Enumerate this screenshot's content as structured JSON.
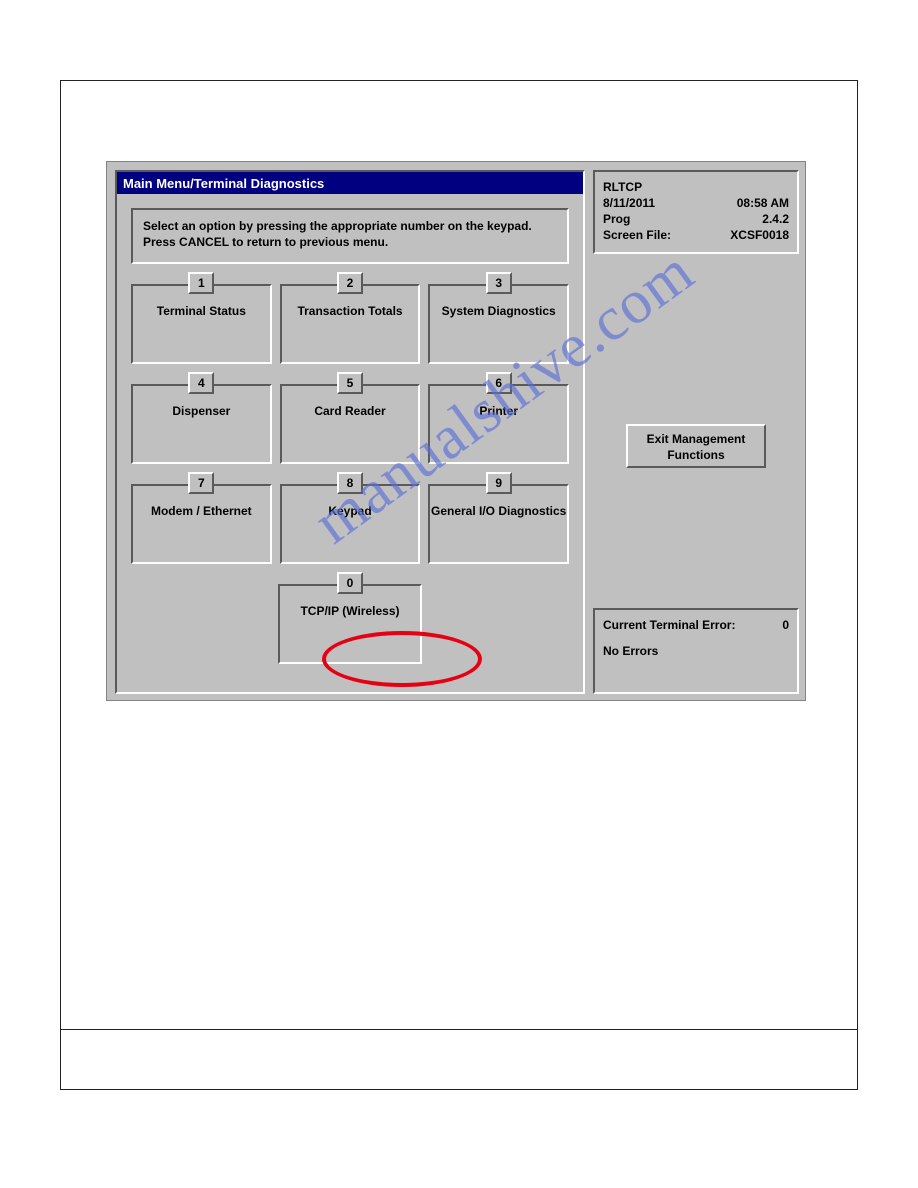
{
  "titlebar": "Main Menu/Terminal Diagnostics",
  "instruction": "Select an option by pressing the appropriate number on the keypad.  Press CANCEL to return to previous menu.",
  "options": [
    {
      "num": "1",
      "label": "Terminal Status"
    },
    {
      "num": "2",
      "label": "Transaction Totals"
    },
    {
      "num": "3",
      "label": "System Diagnostics"
    },
    {
      "num": "4",
      "label": "Dispenser"
    },
    {
      "num": "5",
      "label": "Card Reader"
    },
    {
      "num": "6",
      "label": "Printer"
    },
    {
      "num": "7",
      "label": "Modem / Ethernet"
    },
    {
      "num": "8",
      "label": "Keypad"
    },
    {
      "num": "9",
      "label": "General I/O Diagnostics"
    },
    {
      "num": "0",
      "label": "TCP/IP (Wireless)"
    }
  ],
  "info": {
    "name": "RLTCP",
    "date": "8/11/2011",
    "time": "08:58 AM",
    "prog_label": "Prog",
    "prog_value": "2.4.2",
    "screen_label": "Screen File:",
    "screen_value": "XCSF0018"
  },
  "exit_button": "Exit Management Functions",
  "error": {
    "label": "Current Terminal Error:",
    "code": "0",
    "status": "No Errors"
  },
  "watermark": "manualshive.com"
}
